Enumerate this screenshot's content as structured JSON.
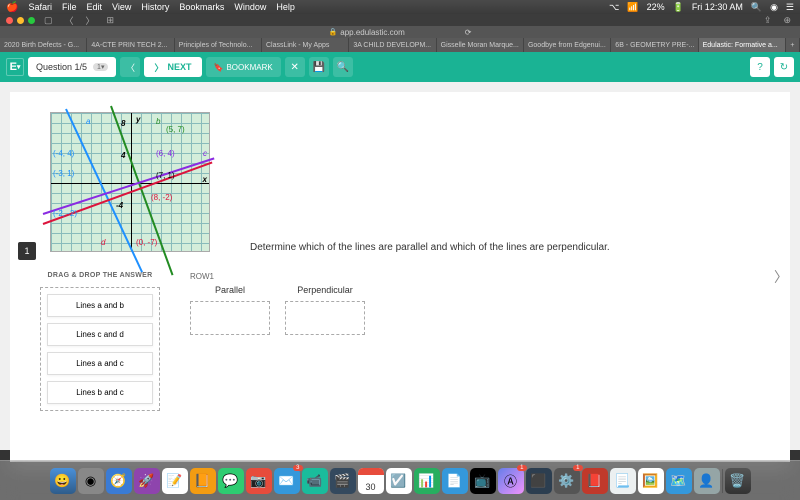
{
  "menubar": {
    "app": "Safari",
    "items": [
      "File",
      "Edit",
      "View",
      "History",
      "Bookmarks",
      "Window",
      "Help"
    ],
    "wifi": "22%",
    "battery": "⎓",
    "time": "Fri 12:30 AM"
  },
  "url": "app.edulastic.com",
  "tabs": [
    "2020 Birth Defects - G...",
    "4A-CTE PRIN TECH 2...",
    "Principles of Technolo...",
    "ClassLink - My Apps",
    "3A CHILD DEVELOPM...",
    "Gisselle Moran Marque...",
    "Goodbye from Edgenui...",
    "6B - GEOMETRY PRE-...",
    "Edulastic: Formative a..."
  ],
  "toolbar": {
    "logo": "E",
    "question": "Question 1/5",
    "qbadge": "1",
    "next": "NEXT",
    "bookmark": "BOOKMARK"
  },
  "question": {
    "number": "1",
    "text": "Determine which of the lines are parallel and which of the lines are perpendicular.",
    "graph": {
      "lines": [
        "a",
        "b",
        "c",
        "d"
      ],
      "ylabel": "y",
      "xlabel": "x",
      "yticks": [
        "8",
        "4",
        "-4"
      ],
      "points": {
        "a_label": "a",
        "b_label": "b",
        "c_label": "c",
        "d_label": "d",
        "p1": "(-4, 4)",
        "p2": "(-3, 1)",
        "p3": "(-2, -2)",
        "p4": "(5, 7)",
        "p5": "(6, 4)",
        "p6": "(7, 1)",
        "p7": "(8, -2)",
        "p8": "(0, -7)"
      }
    }
  },
  "drag": {
    "title": "DRAG & DROP THE ANSWER",
    "items": [
      "Lines a and b",
      "Lines c and d",
      "Lines a and c",
      "Lines b and c"
    ]
  },
  "drop": {
    "row": "ROW1",
    "cols": [
      "Parallel",
      "Perpendicular"
    ]
  },
  "dock": {
    "calendar_day": "30",
    "badges": {
      "mail": "3",
      "appstore": "1",
      "sys": "1"
    }
  }
}
